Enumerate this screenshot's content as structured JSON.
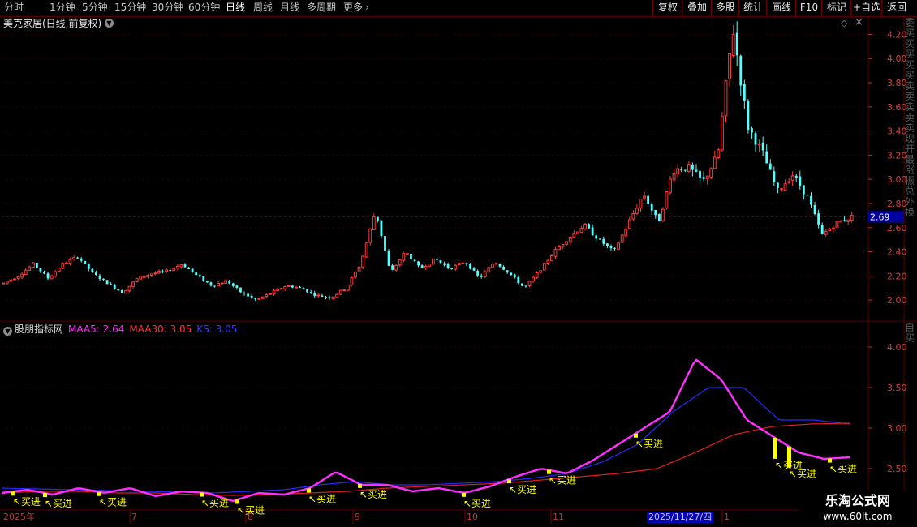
{
  "toolbar": {
    "periods": [
      "分时",
      "1分钟",
      "5分钟",
      "15分钟",
      "30分钟",
      "60分钟",
      "日线",
      "周线",
      "月线",
      "多周期",
      "更多"
    ],
    "active_period": "日线",
    "right_buttons": [
      "复权",
      "叠加",
      "多股",
      "统计",
      "画线",
      "F10",
      "标记",
      "+自选",
      "返回"
    ]
  },
  "stock": {
    "title": "美克家居(日线,前复权)",
    "last_price_tag": "2.69"
  },
  "indicator": {
    "name": "股朋指标网",
    "maa5": "MAA5: 2.64",
    "maa30": "MAA30: 3.05",
    "ks": "KS: 3.05",
    "signal_label": "买进"
  },
  "xaxis": {
    "labels": [
      "2025年",
      "7",
      "8",
      "9",
      "10",
      "11",
      "1"
    ],
    "highlight_date": "2025/11/27/四"
  },
  "watermark": {
    "line1": "乐淘公式网",
    "line2": "www.60lt.com"
  },
  "side_text": "委买买买买买卖卖卖卖卖现开最涨振总外换",
  "side_text2": "自买",
  "colors": {
    "up": "#ff3b3b",
    "down": "#54ffff",
    "maa5": "#ff30ff",
    "maa30": "#e02020",
    "ks": "#2a2aff",
    "signal": "#ffff00",
    "grid": "#5a0000"
  },
  "chart_data": [
    {
      "type": "candlestick",
      "yticks": [
        2.0,
        2.2,
        2.4,
        2.6,
        2.8,
        3.0,
        3.2,
        3.4,
        3.6,
        3.8,
        4.0,
        4.2
      ],
      "ylim": [
        1.86,
        4.32
      ],
      "last_price": 2.69,
      "approx_close_path": [
        2.14,
        2.2,
        2.3,
        2.18,
        2.3,
        2.36,
        2.22,
        2.14,
        2.06,
        2.18,
        2.22,
        2.24,
        2.3,
        2.2,
        2.12,
        2.16,
        2.06,
        2.0,
        2.06,
        2.12,
        2.1,
        2.04,
        2.02,
        2.1,
        2.3,
        2.74,
        2.22,
        2.4,
        2.26,
        2.34,
        2.26,
        2.32,
        2.18,
        2.32,
        2.22,
        2.1,
        2.24,
        2.4,
        2.52,
        2.62,
        2.5,
        2.4,
        2.64,
        2.88,
        2.64,
        3.08,
        3.1,
        2.98,
        3.2,
        4.26,
        3.44,
        3.22,
        2.9,
        3.04,
        2.86,
        2.54,
        2.64,
        2.69
      ]
    },
    {
      "type": "line",
      "yticks": [
        2.5,
        3.0,
        3.5,
        4.0
      ],
      "ylim": [
        2.0,
        4.3
      ],
      "series": [
        {
          "name": "MAA5",
          "approx_path": [
            2.2,
            2.24,
            2.18,
            2.26,
            2.2,
            2.26,
            2.16,
            2.22,
            2.2,
            2.1,
            2.2,
            2.18,
            2.26,
            2.46,
            2.3,
            2.3,
            2.22,
            2.26,
            2.2,
            2.28,
            2.4,
            2.5,
            2.44,
            2.6,
            2.8,
            3.0,
            3.2,
            3.85,
            3.6,
            3.1,
            2.9,
            2.7,
            2.62,
            2.64
          ]
        },
        {
          "name": "MAA30",
          "approx_path": [
            2.2,
            2.22,
            2.22,
            2.2,
            2.2,
            2.18,
            2.17,
            2.18,
            2.2,
            2.22,
            2.26,
            2.28,
            2.3,
            2.32,
            2.36,
            2.4,
            2.44,
            2.5,
            2.7,
            2.92,
            3.02,
            3.05,
            3.06
          ]
        },
        {
          "name": "KS",
          "approx_path": [
            2.26,
            2.25,
            2.24,
            2.23,
            2.22,
            2.21,
            2.2,
            2.22,
            2.24,
            2.3,
            2.34,
            2.3,
            2.3,
            2.32,
            2.34,
            2.38,
            2.44,
            2.58,
            2.8,
            3.2,
            3.5,
            3.5,
            3.1,
            3.1,
            3.05
          ]
        }
      ]
    }
  ]
}
